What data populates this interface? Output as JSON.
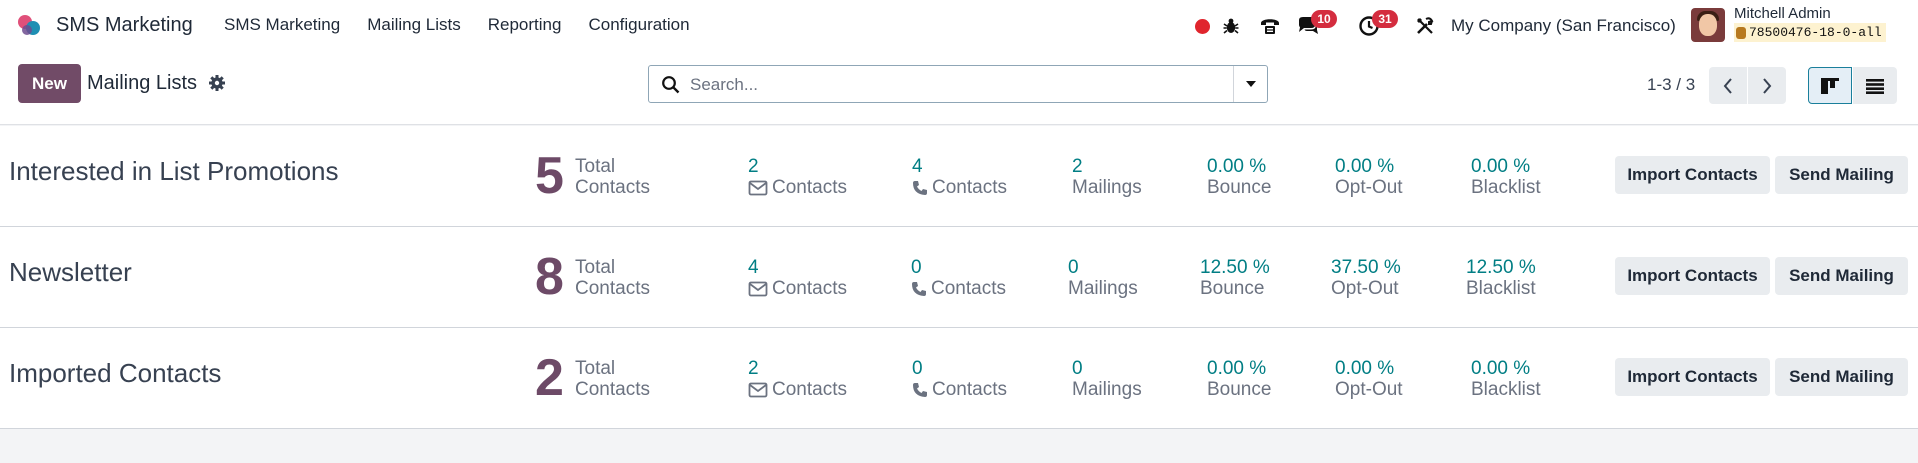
{
  "navbar": {
    "app_name": "SMS Marketing",
    "menu": [
      "SMS Marketing",
      "Mailing Lists",
      "Reporting",
      "Configuration"
    ],
    "messages_badge": "10",
    "activities_badge": "31",
    "company": "My Company (San Francisco)",
    "user_name": "Mitchell Admin",
    "database": "78500476-18-0-all",
    "icons": [
      "record-dot-icon",
      "bug-icon",
      "phone-icon",
      "chat-icon",
      "clock-icon",
      "tools-icon"
    ]
  },
  "control": {
    "new_label": "New",
    "breadcrumb": "Mailing Lists",
    "search_placeholder": "Search...",
    "pager": "1-3 / 3"
  },
  "colors": {
    "brand": "#714b67",
    "accent_teal": "#017e84",
    "badge_red": "#d42d3f"
  },
  "rows": [
    {
      "name": "Interested in List Promotions",
      "total": "5",
      "total_label_1": "Total",
      "total_label_2": "Contacts",
      "email_contacts": "2",
      "sms_contacts": "4",
      "mailings": "2",
      "bounce": "0.00 %",
      "opt_out": "0.00 %",
      "blacklist": "0.00 %"
    },
    {
      "name": "Newsletter",
      "total": "8",
      "total_label_1": "Total",
      "total_label_2": "Contacts",
      "email_contacts": "4",
      "sms_contacts": "0",
      "mailings": "0",
      "bounce": "12.50 %",
      "opt_out": "37.50 %",
      "blacklist": "12.50 %"
    },
    {
      "name": "Imported Contacts",
      "total": "2",
      "total_label_1": "Total",
      "total_label_2": "Contacts",
      "email_contacts": "2",
      "sms_contacts": "0",
      "mailings": "0",
      "bounce": "0.00 %",
      "opt_out": "0.00 %",
      "blacklist": "0.00 %"
    }
  ],
  "labels": {
    "contacts": "Contacts",
    "mailings": "Mailings",
    "bounce": "Bounce",
    "opt_out": "Opt-Out",
    "blacklist": "Blacklist",
    "import_contacts": "Import Contacts",
    "send_mailing": "Send Mailing"
  }
}
